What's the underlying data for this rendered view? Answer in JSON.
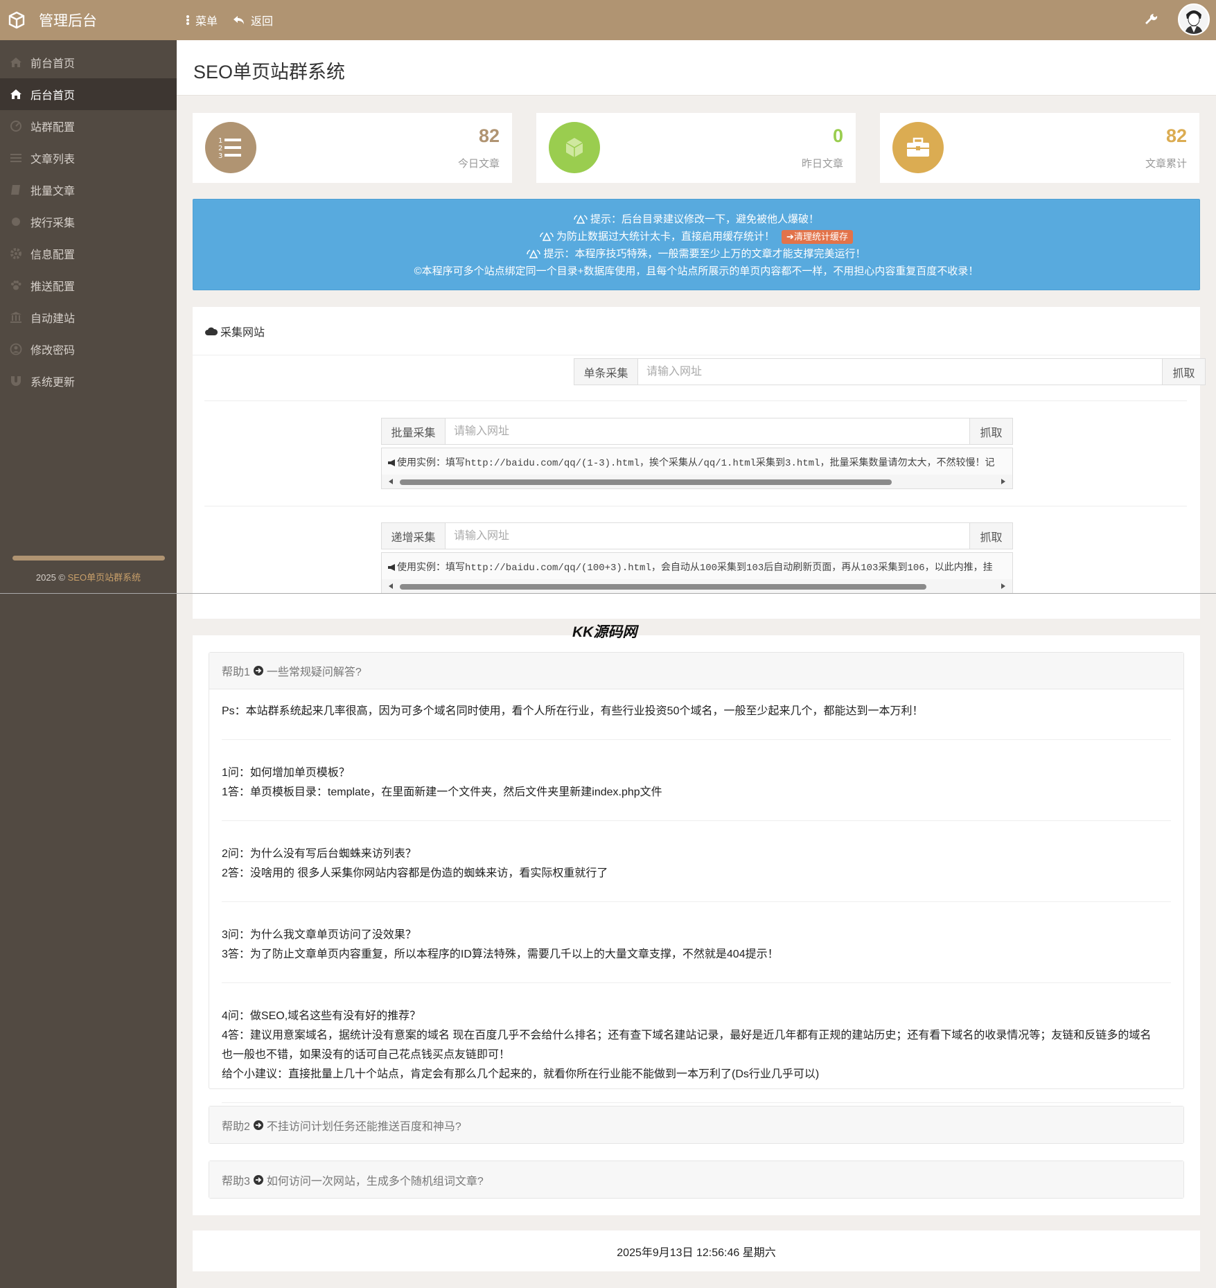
{
  "topbar": {
    "title": "管理后台",
    "nav": [
      {
        "label": "菜单",
        "icon": "menu-dots-icon"
      },
      {
        "label": "返回",
        "icon": "reply-icon"
      }
    ],
    "colors": {
      "bar": "#b09472",
      "sidebar": "#524a42"
    }
  },
  "sidebar": {
    "items": [
      {
        "label": "前台首页",
        "icon": "home-icon"
      },
      {
        "label": "后台首页",
        "icon": "home-icon",
        "active": true
      },
      {
        "label": "站群配置",
        "icon": "gauge-icon"
      },
      {
        "label": "文章列表",
        "icon": "list-icon"
      },
      {
        "label": "批量文章",
        "icon": "book-icon"
      },
      {
        "label": "按行采集",
        "icon": "circle-icon"
      },
      {
        "label": "信息配置",
        "icon": "cog-icon"
      },
      {
        "label": "推送配置",
        "icon": "paw-icon"
      },
      {
        "label": "自动建站",
        "icon": "bank-icon"
      },
      {
        "label": "修改密码",
        "icon": "user-circle-icon"
      },
      {
        "label": "系统更新",
        "icon": "magnet-icon"
      }
    ],
    "footer_prefix": "2025 © ",
    "footer_link": "SEO单页站群系统"
  },
  "page": {
    "title": "SEO单页站群系统"
  },
  "stats": [
    {
      "value": "82",
      "label": "今日文章",
      "icon": "ordered-list-icon",
      "color": "#b09472"
    },
    {
      "value": "0",
      "label": "昨日文章",
      "icon": "cube-icon",
      "color": "#9acd4f"
    },
    {
      "value": "82",
      "label": "文章累计",
      "icon": "briefcase-icon",
      "color": "#dbac52"
    }
  ],
  "notice": {
    "line1": "提示：后台目录建议修改一下，避免被他人爆破！",
    "line2": "为防止数据过大统计太卡，直接启用缓存统计！",
    "line2_button": "➔清理统计缓存",
    "line3": "提示：本程序技巧特殊，一般需要至少上万的文章才能支撑完美运行！",
    "line4": "©本程序可多个站点绑定同一个目录+数据库使用，且每个站点所展示的单页内容都不一样，不用担心内容重复百度不收录！",
    "bg_color": "#58aade"
  },
  "collect": {
    "title": "采集网站",
    "rows": [
      {
        "label": "单条采集",
        "placeholder": "请输入网址",
        "button": "抓取"
      },
      {
        "label": "批量采集",
        "placeholder": "请输入网址",
        "button": "抓取",
        "example": "使用实例：填写http://baidu.com/qq/(1-3).html，挨个采集从/qq/1.html采集到3.html，批量采集数量请勿太大，不然较慢！记"
      },
      {
        "label": "递增采集",
        "placeholder": "请输入网址",
        "button": "抓取",
        "example": "使用实例：填写http://baidu.com/qq/(100+3).html，会自动从100采集到103后自动刷新页面，再从103采集到106，以此内推，挂"
      }
    ]
  },
  "watermark": "KK源码网",
  "help": [
    {
      "prefix": "帮助1",
      "title": "一些常规疑问解答?",
      "items": [
        {
          "lines": [
            "Ps：本站群系统起来几率很高，因为可多个域名同时使用，看个人所在行业，有些行业投资50个域名，一般至少起来几个，都能达到一本万利！"
          ]
        },
        {
          "lines": [
            "1问：如何增加单页模板？",
            "1答：单页模板目录：template，在里面新建一个文件夹，然后文件夹里新建index.php文件"
          ]
        },
        {
          "lines": [
            "2问：为什么没有写后台蜘蛛来访列表？",
            "2答：没啥用的 很多人采集你网站内容都是伪造的蜘蛛来访，看实际权重就行了"
          ]
        },
        {
          "lines": [
            "3问：为什么我文章单页访问了没效果？",
            "3答：为了防止文章单页内容重复，所以本程序的ID算法特殊，需要几千以上的大量文章支撑，不然就是404提示！"
          ]
        },
        {
          "lines": [
            "4问：做SEO,域名这些有没有好的推荐？",
            "4答：建议用意案域名，据统计没有意案的域名 现在百度几乎不会给什么排名；还有查下域名建站记录，最好是近几年都有正规的建站历史；还有看下域名的收录情况等；友链和反链多的域名",
            "也一般也不错，如果没有的话可自己花点钱买点友链即可！",
            "给个小建议：直接批量上几十个站点，肯定会有那么几个起来的，就看你所在行业能不能做到一本万利了(Ds行业几乎可以)"
          ]
        }
      ]
    },
    {
      "prefix": "帮助2",
      "title": "不挂访问计划任务还能推送百度和神马?"
    },
    {
      "prefix": "帮助3",
      "title": "如何访问一次网站，生成多个随机组词文章?"
    }
  ],
  "footer": {
    "datetime": "2025年9月13日 12:56:46 星期六"
  }
}
